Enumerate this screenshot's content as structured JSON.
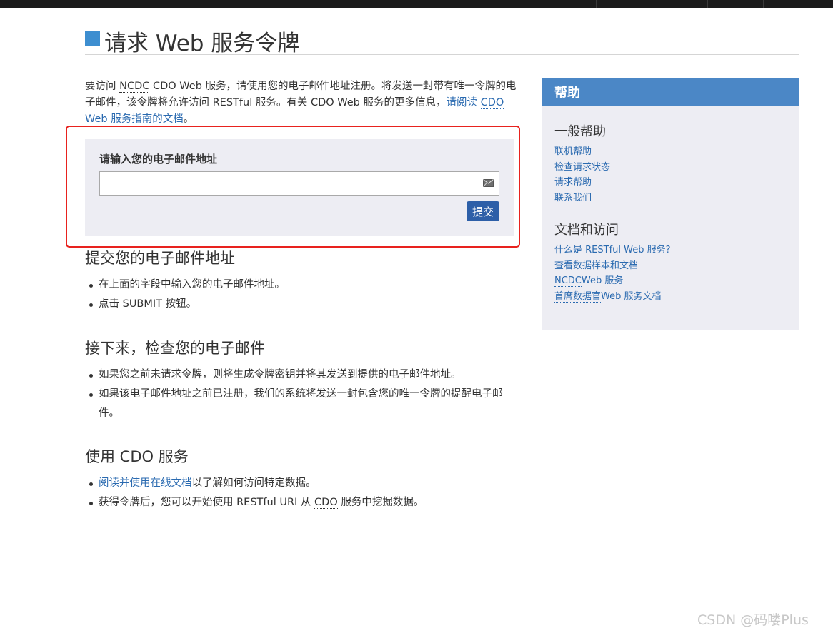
{
  "header": {
    "title": "请求 Web 服务令牌"
  },
  "intro": {
    "text_1": "要访问 ",
    "abbr_1": "NCDC",
    "text_2": " CDO Web 服务，请使用您的电子邮件地址注册。将发送一封带有唯一令牌的电子邮件，该令牌将允许访问 RESTful 服务。有关 CDO Web 服务的更多信息，",
    "link_text_1": "请阅读 ",
    "link_abbr": "CDO",
    "link_text_2": " Web 服务指南的文档",
    "text_3": "。"
  },
  "form": {
    "label": "请输入您的电子邮件地址",
    "email_value": "",
    "email_placeholder": "",
    "submit_label": "提交",
    "icon": "envelope-icon"
  },
  "sections": {
    "submit": {
      "title": "提交您的电子邮件地址",
      "items": [
        "在上面的字段中输入您的电子邮件地址。",
        "点击 SUBMIT 按钮。"
      ]
    },
    "check": {
      "title": "接下来，检查您的电子邮件",
      "items": [
        "如果您之前未请求令牌，则将生成令牌密钥并将其发送到提供的电子邮件地址。",
        "如果该电子邮件地址之前已注册，我们的系统将发送一封包含您的唯一令牌的提醒电子邮件。"
      ]
    },
    "use": {
      "title": "使用 CDO 服务",
      "item_1_link": "阅读并使用在线文档",
      "item_1_text": "以了解如何访问特定数据。",
      "item_2_text_1": "获得令牌后，您可以开始使用 RESTful URI 从 ",
      "item_2_abbr": "CDO",
      "item_2_text_2": " 服务中挖掘数据。"
    }
  },
  "sidebar": {
    "title": "帮助",
    "general": {
      "title": "一般帮助",
      "links": [
        "联机帮助",
        "检查请求状态",
        "请求帮助",
        "联系我们"
      ]
    },
    "docs": {
      "title": "文档和访问",
      "link_1": "什么是 RESTful Web 服务?",
      "link_2": "查看数据样本和文档",
      "link_3_abbr": "NCDC",
      "link_3_text": "Web 服务",
      "link_4_abbr": "首席数据官",
      "link_4_text": "Web 服务文档"
    }
  },
  "watermark": "CSDN @码喽Plus",
  "colors": {
    "accent": "#3d8ed0",
    "sidebar_header": "#4b87c6",
    "panel_bg": "#ededf3",
    "link": "#2a6ab0",
    "button": "#2d5fa8",
    "highlight_border": "#e8221e",
    "topbar": "#1b1b1b"
  }
}
